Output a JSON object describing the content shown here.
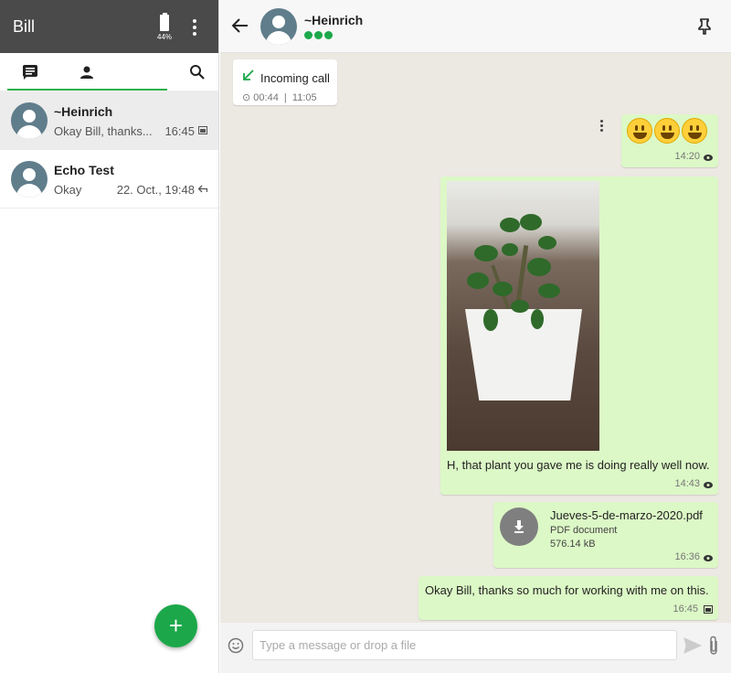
{
  "sidebar": {
    "title": "Bill",
    "battery": "44%",
    "chats": [
      {
        "name": "~Heinrich",
        "last": "Okay Bill, thanks...",
        "time": "16:45"
      },
      {
        "name": "Echo Test",
        "last": "Okay",
        "time": "22. Oct., 19:48"
      }
    ],
    "fab": "+"
  },
  "conversation": {
    "contact_name": "~Heinrich",
    "call": {
      "label": "Incoming call",
      "duration": "00:44",
      "time": "11:05"
    },
    "emoji_message": {
      "time": "14:20"
    },
    "photo_message": {
      "caption": "H, that plant you gave me is doing really well now.",
      "time": "14:43"
    },
    "file_message": {
      "name": "Jueves-5-de-marzo-2020.pdf",
      "type": "PDF document",
      "size": "576.14 kB",
      "time": "16:36"
    },
    "text_message": {
      "text": "Okay Bill, thanks so much for working with me on this.",
      "time": "16:45"
    }
  },
  "composer": {
    "placeholder": "Type a message or drop a file"
  }
}
